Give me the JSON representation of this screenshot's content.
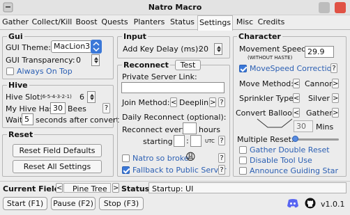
{
  "window": {
    "title": "Natro Macro"
  },
  "tabs": [
    "Gather",
    "Collect/Kill",
    "Boost",
    "Quests",
    "Planters",
    "Status",
    "Settings",
    "Misc",
    "Credits"
  ],
  "active_tab": "Settings",
  "gui": {
    "title": "Gui",
    "theme_label": "GUI Theme:",
    "theme_value": "MacLion3",
    "transparency_label": "GUI Transparency:",
    "transparency_value": "0",
    "always_on_top_label": "Always On Top"
  },
  "hive": {
    "title": "Hive",
    "slot_label": "Hive Slot:",
    "slot_hint": "(6-5-4-3-2-1)",
    "slot_value": "6",
    "has_label": "My Hive Has:",
    "has_value": "30",
    "bees_label": "Bees",
    "help": "?",
    "wait_label": "Wait",
    "wait_value": "5",
    "wait_suffix": "seconds after convert"
  },
  "reset": {
    "title": "Reset",
    "field_defaults": "Reset Field Defaults",
    "all_settings": "Reset All Settings"
  },
  "input": {
    "title": "Input",
    "key_delay_label": "Add Key Delay (ms):",
    "key_delay_value": "20"
  },
  "reconnect": {
    "title": "Reconnect",
    "test_button": "Test",
    "private_server_label": "Private Server Link:",
    "private_server_value": "",
    "join_method_label": "Join Method:",
    "join_method_value": "Deeplink",
    "daily_label": "Daily Reconnect (optional):",
    "every_label": "Reconnect every",
    "every_value": "",
    "hours_label": "hours",
    "starting_label": "starting at",
    "start_hour": "",
    "start_minute": "",
    "utc_label": "UTC",
    "natro_broke_label": "Natro so broke",
    "emoji": "😩",
    "fallback_label": "Fallback to Public Server"
  },
  "character": {
    "title": "Character",
    "speed_label": "Movement Speed:",
    "speed_note": "(WITHOUT HASTE)",
    "speed_value": "29.9",
    "speed_correction_label": "MoveSpeed Correction",
    "move_method_label": "Move Method:",
    "move_method_value": "Cannon",
    "sprinkler_label": "Sprinkler Type:",
    "sprinkler_value": "Silver",
    "convert_label": "Convert Balloon:",
    "convert_value": "Gather",
    "mins_value": "30",
    "mins_label": "Mins",
    "multiple_reset_label": "Multiple Reset:",
    "gather_double_reset": "Gather Double Reset",
    "disable_tool_use": "Disable Tool Use",
    "announce_guiding_star": "Announce Guiding Star"
  },
  "status": {
    "current_field_label": "Current Field:",
    "current_field_value": "Pine Tree",
    "status_label": "Status:",
    "status_value": "Startup: UI"
  },
  "footer": {
    "start": "Start (F1)",
    "pause": "Pause (F2)",
    "stop": "Stop (F3)",
    "version": "v1.0.1"
  },
  "colors": {
    "accent": "#3b78d8",
    "discord": "#5865f2",
    "close": "#e05245"
  }
}
